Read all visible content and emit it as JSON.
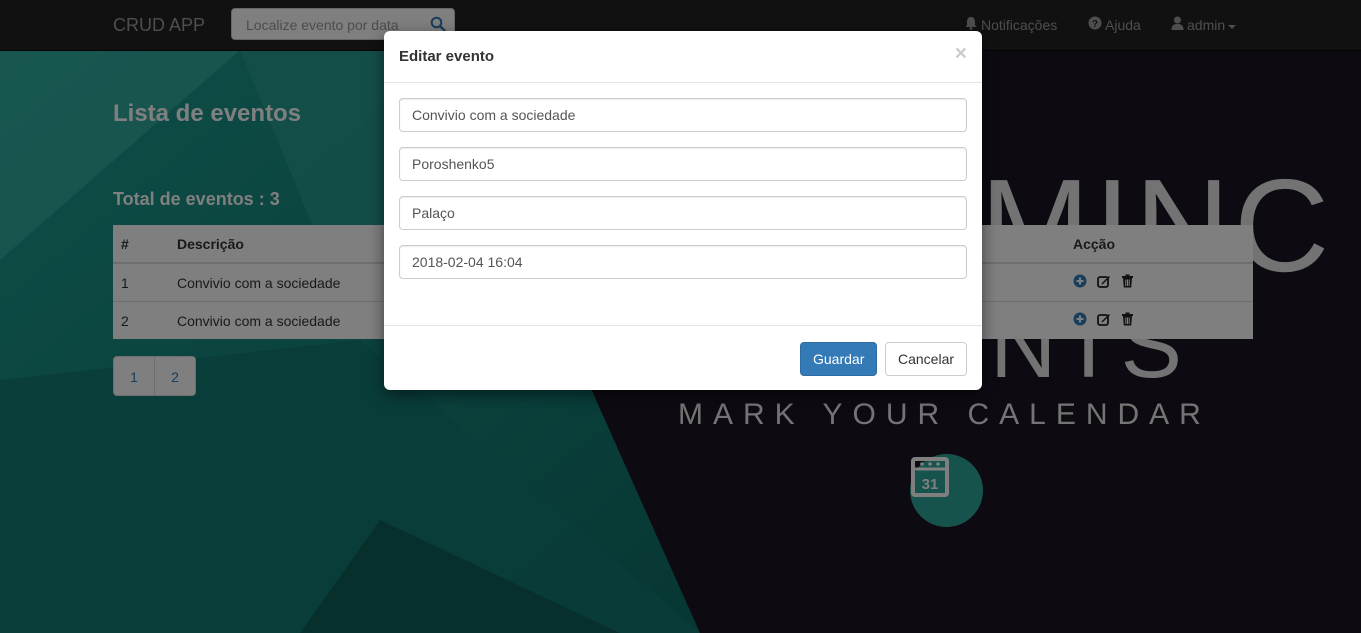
{
  "navbar": {
    "brand": "CRUD APP",
    "search_placeholder": "Localize evento por data",
    "notifications": "Notificações",
    "help": "Ajuda",
    "user": "admin"
  },
  "page": {
    "title": "Lista de eventos",
    "total": "Total de eventos : 3"
  },
  "background": {
    "headline_top": "MINC",
    "headline_bottom": "NTS",
    "tagline": "MARK YOUR CALENDAR",
    "calendar_day": "31"
  },
  "table": {
    "headers": {
      "num": "#",
      "description": "Descrição",
      "action": "Acção"
    },
    "rows": [
      {
        "num": "1",
        "description": "Convivio com a sociedade"
      },
      {
        "num": "2",
        "description": "Convivio com a sociedade"
      }
    ]
  },
  "pagination": [
    "1",
    "2"
  ],
  "modal": {
    "title": "Editar evento",
    "close": "×",
    "fields": {
      "description": "Convivio com a sociedade",
      "organizer": "Poroshenko5",
      "location": "Palaço",
      "datetime": "2018-02-04 16:04"
    },
    "save_label": "Guardar",
    "cancel_label": "Cancelar"
  },
  "colors": {
    "primary": "#337ab7",
    "navbar": "#222222",
    "teal": "#2ea69a"
  }
}
